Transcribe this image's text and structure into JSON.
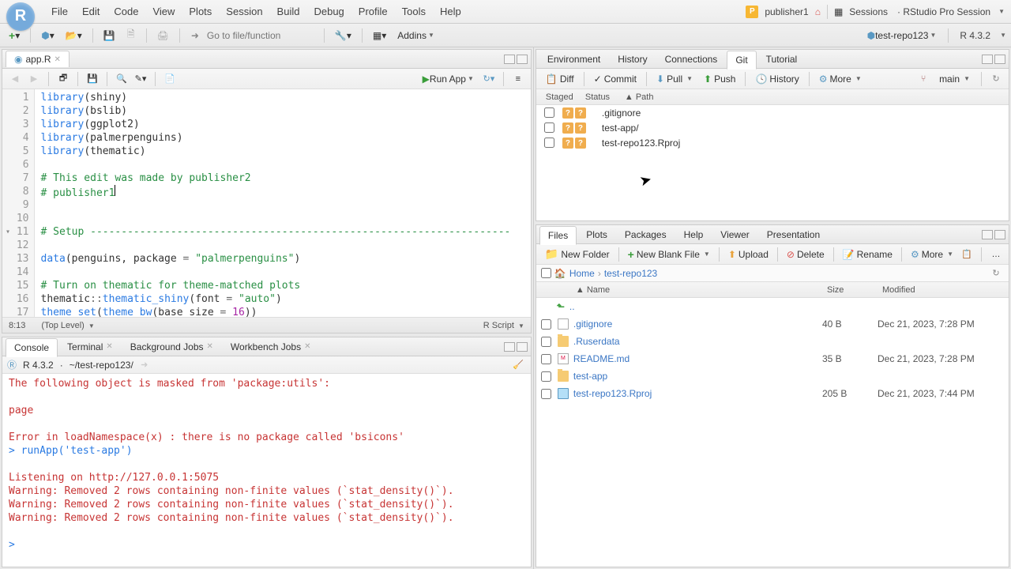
{
  "menubar": {
    "items": [
      "File",
      "Edit",
      "Code",
      "View",
      "Plots",
      "Session",
      "Build",
      "Debug",
      "Profile",
      "Tools",
      "Help"
    ],
    "user": "publisher1",
    "sessions": "Sessions",
    "session_name": "RStudio Pro Session"
  },
  "toolbar": {
    "goto_placeholder": "Go to file/function",
    "addins": "Addins",
    "project": "test-repo123",
    "r_version": "R 4.3.2"
  },
  "source": {
    "tab_name": "app.R",
    "run_app": "Run App",
    "lines": [
      {
        "n": 1,
        "html": "<span class=\"tok-fn\">library</span>(shiny)"
      },
      {
        "n": 2,
        "html": "<span class=\"tok-fn\">library</span>(bslib)"
      },
      {
        "n": 3,
        "html": "<span class=\"tok-fn\">library</span>(ggplot2)"
      },
      {
        "n": 4,
        "html": "<span class=\"tok-fn\">library</span>(palmerpenguins)"
      },
      {
        "n": 5,
        "html": "<span class=\"tok-fn\">library</span>(thematic)"
      },
      {
        "n": 6,
        "html": ""
      },
      {
        "n": 7,
        "html": "<span class=\"tok-cmt\"># This edit was made by publisher2</span>"
      },
      {
        "n": 8,
        "html": "<span class=\"tok-cmt\"># publisher1</span>",
        "cursor": true
      },
      {
        "n": 9,
        "html": ""
      },
      {
        "n": 10,
        "html": ""
      },
      {
        "n": 11,
        "html": "<span class=\"tok-cmt\"># Setup --------------------------------------------------------------------</span>",
        "fold": true
      },
      {
        "n": 12,
        "html": ""
      },
      {
        "n": 13,
        "html": "<span class=\"tok-fn\">data</span>(penguins, package <span class=\"tok-op\">=</span> <span class=\"tok-str\">\"palmerpenguins\"</span>)"
      },
      {
        "n": 14,
        "html": ""
      },
      {
        "n": 15,
        "html": "<span class=\"tok-cmt\"># Turn on thematic for theme-matched plots</span>"
      },
      {
        "n": 16,
        "html": "thematic<span class=\"tok-op\">::</span><span class=\"tok-fn\">thematic_shiny</span>(font <span class=\"tok-op\">=</span> <span class=\"tok-str\">\"auto\"</span>)"
      },
      {
        "n": 17,
        "html": "<span class=\"tok-fn\">theme_set</span>(<span class=\"tok-fn\">theme_bw</span>(base_size <span class=\"tok-op\">=</span> <span class=\"tok-num\">16</span>))"
      }
    ],
    "status_pos": "8:13",
    "status_scope": "(Top Level)",
    "status_type": "R Script"
  },
  "console_tabs": [
    "Console",
    "Terminal",
    "Background Jobs",
    "Workbench Jobs"
  ],
  "console": {
    "header_version": "R 4.3.2",
    "header_path": "~/test-repo123/",
    "lines": [
      {
        "cls": "con-red",
        "text": "The following object is masked from 'package:utils':"
      },
      {
        "cls": "",
        "text": ""
      },
      {
        "cls": "con-red",
        "text": "    page"
      },
      {
        "cls": "",
        "text": ""
      },
      {
        "cls": "con-red",
        "text": "Error in loadNamespace(x) : there is no package called 'bsicons'"
      },
      {
        "cls": "con-blue",
        "text": "> runApp('test-app')"
      },
      {
        "cls": "",
        "text": ""
      },
      {
        "cls": "con-red",
        "text": "Listening on http://127.0.0.1:5075"
      },
      {
        "cls": "con-red",
        "text": "Warning: Removed 2 rows containing non-finite values (`stat_density()`)."
      },
      {
        "cls": "con-red",
        "text": "Warning: Removed 2 rows containing non-finite values (`stat_density()`)."
      },
      {
        "cls": "con-red",
        "text": "Warning: Removed 2 rows containing non-finite values (`stat_density()`)."
      },
      {
        "cls": "",
        "text": ""
      },
      {
        "cls": "con-blue",
        "text": "> "
      }
    ]
  },
  "env_tabs": [
    "Environment",
    "History",
    "Connections",
    "Git",
    "Tutorial"
  ],
  "git": {
    "diff": "Diff",
    "commit": "Commit",
    "pull": "Pull",
    "push": "Push",
    "history": "History",
    "more": "More",
    "branch": "main",
    "head_staged": "Staged",
    "head_status": "Status",
    "head_path": "Path",
    "rows": [
      {
        "path": ".gitignore"
      },
      {
        "path": "test-app/"
      },
      {
        "path": "test-repo123.Rproj"
      }
    ]
  },
  "files_tabs": [
    "Files",
    "Plots",
    "Packages",
    "Help",
    "Viewer",
    "Presentation"
  ],
  "files": {
    "new_folder": "New Folder",
    "new_blank": "New Blank File",
    "upload": "Upload",
    "delete": "Delete",
    "rename": "Rename",
    "more": "More",
    "crumb_home": "Home",
    "crumb_repo": "test-repo123",
    "head_name": "Name",
    "head_size": "Size",
    "head_mod": "Modified",
    "rows": [
      {
        "up": true,
        "name": ".."
      },
      {
        "icon": "file",
        "name": ".gitignore",
        "size": "40 B",
        "mod": "Dec 21, 2023, 7:28 PM"
      },
      {
        "icon": "folder",
        "name": ".Ruserdata",
        "size": "",
        "mod": ""
      },
      {
        "icon": "md",
        "name": "README.md",
        "size": "35 B",
        "mod": "Dec 21, 2023, 7:28 PM"
      },
      {
        "icon": "folder",
        "name": "test-app",
        "size": "",
        "mod": ""
      },
      {
        "icon": "rproj",
        "name": "test-repo123.Rproj",
        "size": "205 B",
        "mod": "Dec 21, 2023, 7:44 PM"
      }
    ]
  }
}
